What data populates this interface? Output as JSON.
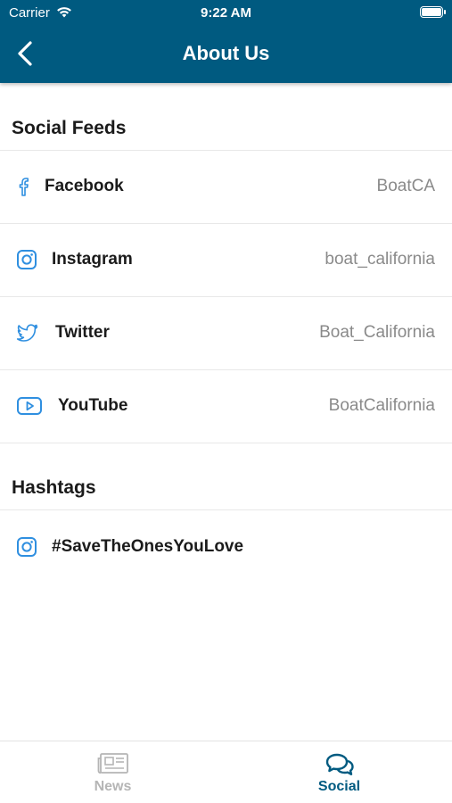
{
  "status_bar": {
    "carrier": "Carrier",
    "time": "9:22 AM"
  },
  "header": {
    "title": "About Us",
    "back_icon": "chevron-left-icon"
  },
  "colors": {
    "primary": "#005a80",
    "accent_icon": "#2f8fe0",
    "handle_gray": "#8a8a8a",
    "tab_inactive": "#b5b5b5"
  },
  "social_feeds": {
    "title": "Social Feeds",
    "items": [
      {
        "icon": "facebook-icon",
        "label": "Facebook",
        "handle": "BoatCA"
      },
      {
        "icon": "instagram-icon",
        "label": "Instagram",
        "handle": "boat_california"
      },
      {
        "icon": "twitter-icon",
        "label": "Twitter",
        "handle": "Boat_California"
      },
      {
        "icon": "youtube-icon",
        "label": "YouTube",
        "handle": "BoatCalifornia"
      }
    ]
  },
  "hashtags": {
    "title": "Hashtags",
    "items": [
      {
        "icon": "instagram-icon",
        "label": "#SaveTheOnesYouLove"
      }
    ]
  },
  "tab_bar": {
    "tabs": [
      {
        "icon": "newspaper-icon",
        "label": "News",
        "active": false
      },
      {
        "icon": "chat-bubbles-icon",
        "label": "Social",
        "active": true
      }
    ]
  }
}
